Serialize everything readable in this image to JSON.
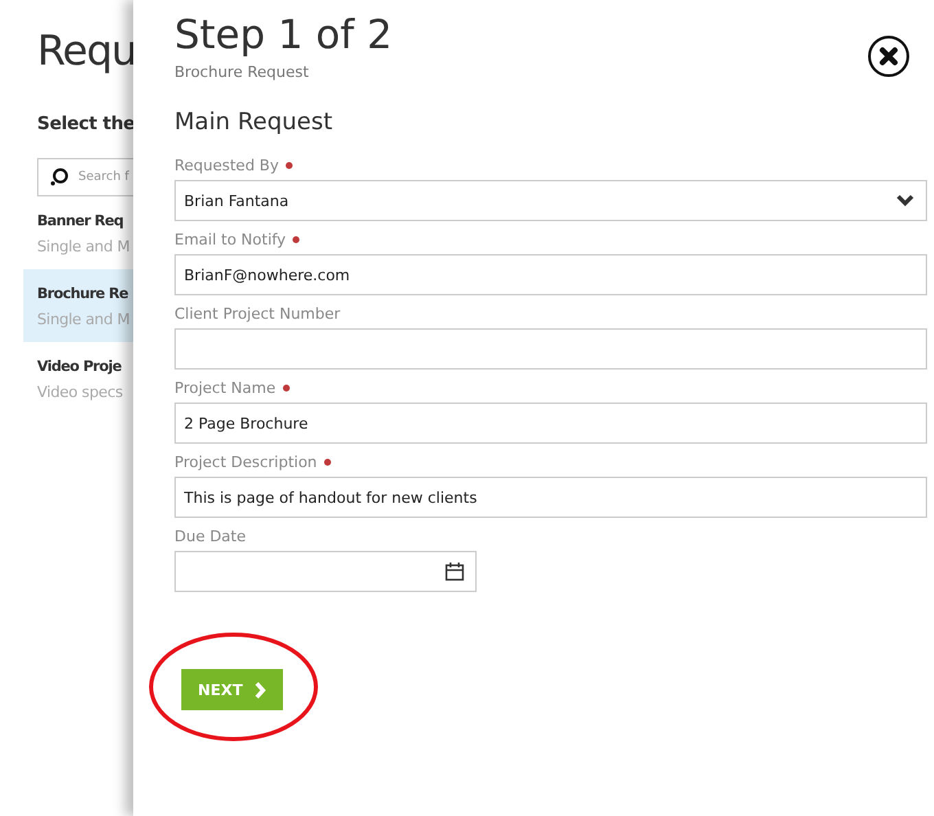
{
  "background": {
    "title": "Requ",
    "section": "Select the",
    "search": {
      "placeholder": "Search f"
    },
    "items": [
      {
        "title": "Banner Req",
        "subtitle": "Single and M",
        "selected": false
      },
      {
        "title": "Brochure Re",
        "subtitle": "Single and M",
        "selected": true
      },
      {
        "title": "Video Proje",
        "subtitle": "Video specs",
        "selected": false
      }
    ]
  },
  "panel": {
    "title": "Step 1 of 2",
    "subtitle": "Brochure Request",
    "section": "Main Request",
    "fields": [
      {
        "kind": "select",
        "label": "Requested By",
        "required": true,
        "value": "Brian Fantana"
      },
      {
        "kind": "text",
        "label": "Email to Notify",
        "required": true,
        "value": "BrianF@nowhere.com"
      },
      {
        "kind": "text",
        "label": "Client Project Number",
        "required": false
      },
      {
        "kind": "text",
        "label": "Project Name",
        "required": true,
        "value": "2 Page Brochure"
      },
      {
        "kind": "text",
        "label": "Project Description",
        "required": true,
        "value": "This is page of handout for new clients"
      },
      {
        "kind": "date",
        "label": "Due Date",
        "required": false
      }
    ],
    "next_button": "NEXT"
  }
}
